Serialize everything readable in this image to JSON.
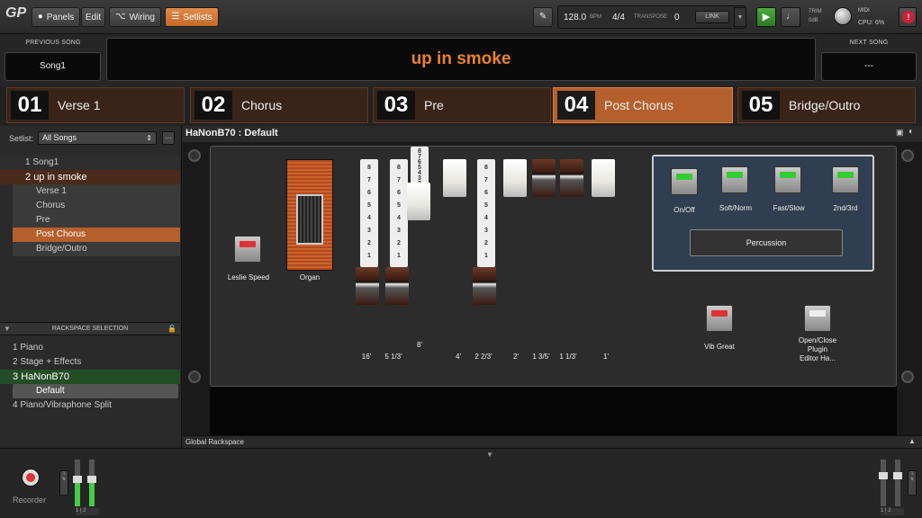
{
  "toolbar": {
    "logo": "GP",
    "panels": "Panels",
    "edit": "Edit",
    "wiring": "Wiring",
    "setlists": "Setlists",
    "bpm_value": "128.0",
    "bpm_label": "BPM",
    "time_sig": "4/4",
    "transpose_label": "TRANSPOSE",
    "transpose_value": "0",
    "link": "LINK",
    "trim_label": "TRIM",
    "trim_value": "0dB",
    "midi_label": "MIDI",
    "cpu_label": "CPU:",
    "cpu_value": "6%",
    "panic": "!"
  },
  "song": {
    "prev_label": "PREVIOUS SONG",
    "prev_value": "Song1",
    "current": "up in smoke",
    "next_label": "NEXT SONG",
    "next_value": "---"
  },
  "parts": [
    {
      "num": "01",
      "name": "Verse 1"
    },
    {
      "num": "02",
      "name": "Chorus"
    },
    {
      "num": "03",
      "name": "Pre"
    },
    {
      "num": "04",
      "name": "Post Chorus"
    },
    {
      "num": "05",
      "name": "Bridge/Outro"
    }
  ],
  "setlist": {
    "label": "Setlist:",
    "selected": "All Songs",
    "songs": [
      {
        "num": "1",
        "name": "Song1"
      },
      {
        "num": "2",
        "name": "up in smoke"
      }
    ],
    "song_parts": [
      "Verse 1",
      "Chorus",
      "Pre",
      "Post Chorus",
      "Bridge/Outro"
    ]
  },
  "rackspace": {
    "header": "RACKSPACE SELECTION",
    "items": [
      {
        "num": "1",
        "name": "Piano"
      },
      {
        "num": "2",
        "name": "Stage + Effects"
      },
      {
        "num": "3",
        "name": "HaNonB70"
      },
      {
        "num": "4",
        "name": "Piano/Vibraphone Split"
      }
    ],
    "variation": "Default"
  },
  "panel": {
    "title": "HaNonB70 : Default",
    "leslie": "Leslie Speed",
    "organ": "Organ",
    "drawbar_numbers": [
      "8",
      "7",
      "6",
      "5",
      "4",
      "3",
      "2",
      "1"
    ],
    "drawbar_labels": [
      "16'",
      "5 1/3'",
      "8'",
      "4'",
      "2 2/3'",
      "2'",
      "1 3/5'",
      "1 1/3'",
      "1'"
    ],
    "perc_buttons": [
      "On/Off",
      "Soft/Norm",
      "Fast/Slow",
      "2nd/3rd"
    ],
    "percussion": "Percussion",
    "vib": "Vib Great",
    "openclose": [
      "Open/Close",
      "Plugin",
      "Editor Ha..."
    ],
    "global": "Global Rackspace"
  },
  "bottom": {
    "recorder": "Recorder"
  },
  "colors": {
    "accent": "#c46a2a",
    "song_title": "#e8822e"
  }
}
